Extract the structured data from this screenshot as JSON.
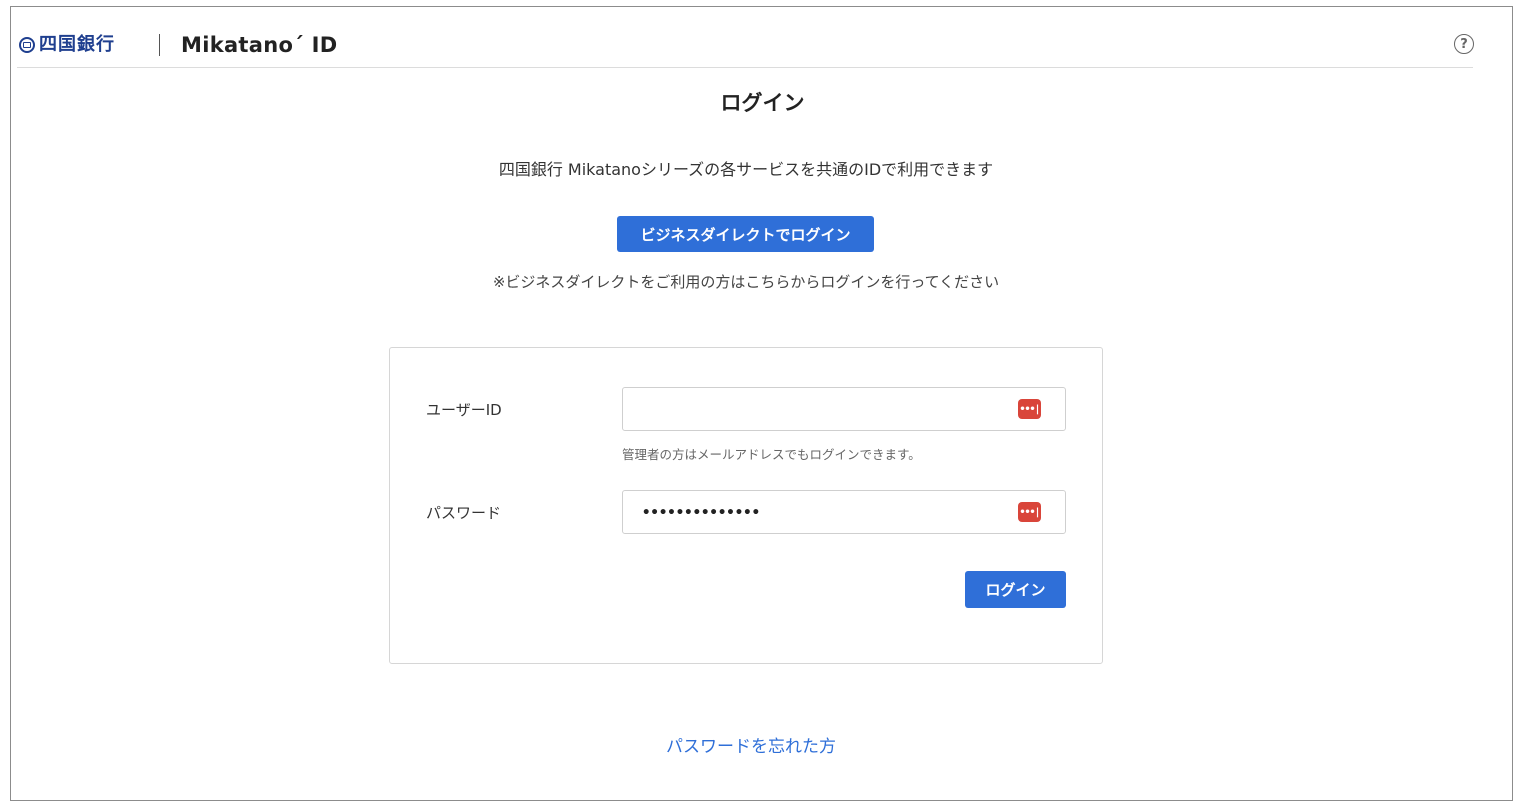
{
  "header": {
    "bank_name": "四国銀行",
    "service_logo": "Mikatano´ ID",
    "help_icon": "question-circle-icon",
    "help_glyph": "?"
  },
  "main": {
    "title": "ログイン",
    "subtitle": "四国銀行 Mikatanoシリーズの各サービスを共通のIDで利用できます",
    "business_direct_button": "ビジネスダイレクトでログイン",
    "business_direct_note": "※ビジネスダイレクトをご利用の方はこちらからログインを行ってください"
  },
  "login_form": {
    "user_id_label": "ユーザーID",
    "user_id_value": "",
    "user_id_hint": "管理者の方はメールアドレスでもログインできます。",
    "password_label": "パスワード",
    "password_masked": "••••••••••••••",
    "password_manager_icon": "password-manager-icon",
    "password_manager_glyph": "•••|",
    "submit_button": "ログイン"
  },
  "footer": {
    "forgot_password_link": "パスワードを忘れた方"
  },
  "colors": {
    "accent": "#2f6fd8",
    "bank_brand": "#1f3f8f",
    "password_manager": "#d9453a"
  }
}
